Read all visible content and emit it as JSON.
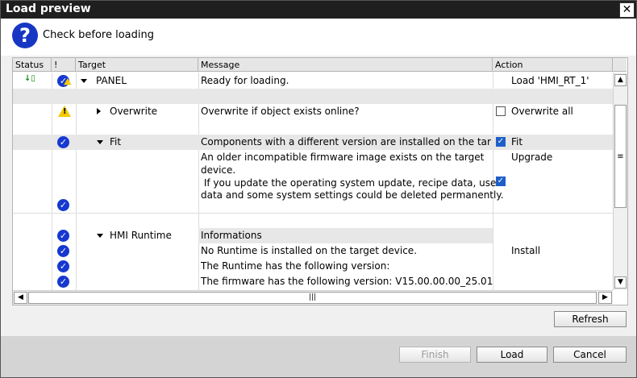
{
  "window": {
    "title": "Load preview",
    "close_label": "✕"
  },
  "header": {
    "text": "Check before loading",
    "icon_label": "?"
  },
  "columns": {
    "status": "Status",
    "flag": "!",
    "target": "Target",
    "message": "Message",
    "action": "Action"
  },
  "rows": {
    "panel": {
      "target": "PANEL",
      "message": "Ready for loading.",
      "action": "Load 'HMI_RT_1'"
    },
    "overwrite": {
      "target": "Overwrite",
      "message": "Overwrite if object exists online?",
      "action": "Overwrite all"
    },
    "fit": {
      "target": "Fit",
      "message": "Components with a different version are installed on the target de",
      "action": "Fit"
    },
    "firmware": {
      "message_1": "An older incompatible firmware image exists on the target",
      "message_2": "device.",
      "message_3": " If you update the operating system update, recipe data, user",
      "message_4": "data and some system settings could be deleted permanently.",
      "action": "Upgrade"
    },
    "hmi_runtime": {
      "target": "HMI Runtime",
      "message": "Informations"
    },
    "no_runtime": {
      "message": "No Runtime is installed on the target device.",
      "action": "Install"
    },
    "runtime_version": {
      "message": "The Runtime has the following version:"
    },
    "firmware_version": {
      "message": "The firmware has the following version: V15.00.00.00_25.01"
    }
  },
  "buttons": {
    "refresh": "Refresh",
    "finish": "Finish",
    "load": "Load",
    "cancel": "Cancel"
  }
}
